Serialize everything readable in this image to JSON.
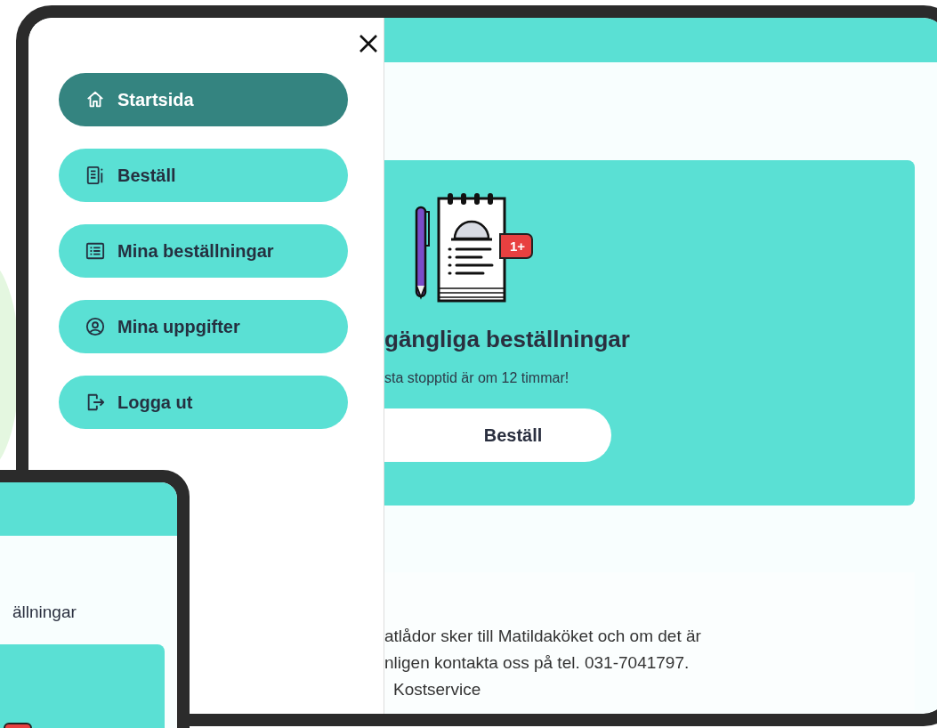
{
  "menu": {
    "items": [
      {
        "label": "Startsida",
        "selected": true
      },
      {
        "label": "Beställ",
        "selected": false
      },
      {
        "label": "Mina beställningar",
        "selected": false
      },
      {
        "label": "Mina uppgifter",
        "selected": false
      },
      {
        "label": "Logga ut",
        "selected": false
      }
    ]
  },
  "order_card": {
    "badge": "1+",
    "title": "gängliga beställningar",
    "subtitle": "sta stopptid är om 12 timmar!",
    "button": "Beställ"
  },
  "info_panel": {
    "lines": [
      "atlådor sker till Matildaköket och om det är",
      "nligen kontakta oss på tel. 031-7041797.",
      "Kostservice"
    ]
  },
  "second_device": {
    "heading": "ällningar"
  }
}
